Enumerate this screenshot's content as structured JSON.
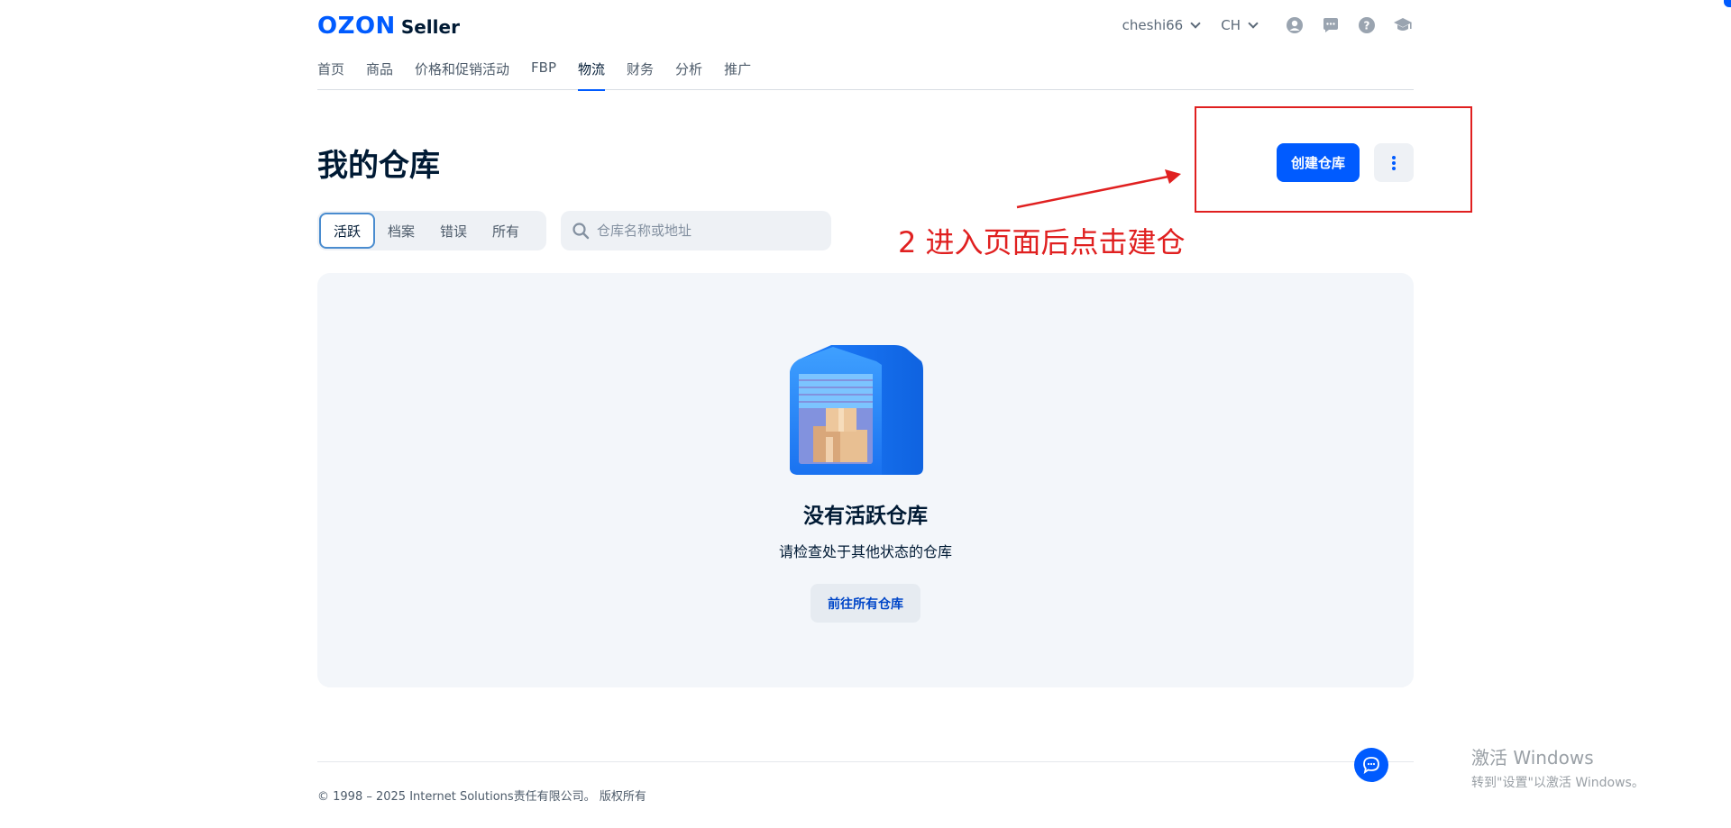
{
  "header": {
    "logo_brand": "OZON",
    "logo_product": "Seller",
    "account": "cheshi66",
    "language": "CH",
    "icons": [
      "profile-icon",
      "chat-icon",
      "help-icon",
      "education-icon"
    ]
  },
  "nav": {
    "items": [
      {
        "label": "首页",
        "active": false
      },
      {
        "label": "商品",
        "active": false
      },
      {
        "label": "价格和促销活动",
        "active": false
      },
      {
        "label": "FBP",
        "active": false
      },
      {
        "label": "物流",
        "active": true
      },
      {
        "label": "财务",
        "active": false
      },
      {
        "label": "分析",
        "active": false
      },
      {
        "label": "推广",
        "active": false
      }
    ]
  },
  "page": {
    "title": "我的仓库",
    "create_button": "创建仓库"
  },
  "filters": {
    "tabs": [
      {
        "label": "活跃",
        "active": true
      },
      {
        "label": "档案",
        "active": false
      },
      {
        "label": "错误",
        "active": false
      },
      {
        "label": "所有",
        "active": false
      }
    ],
    "search_placeholder": "仓库名称或地址"
  },
  "empty_state": {
    "title": "没有活跃仓库",
    "subtitle": "请检查处于其他状态的仓库",
    "button": "前往所有仓库"
  },
  "annotation": {
    "text": "2 进入页面后点击建仓",
    "color": "#e02020"
  },
  "footer": {
    "copyright": "© 1998 – 2025 Internet Solutions责任有限公司。 版权所有"
  },
  "watermark": {
    "line1": "激活 Windows",
    "line2": "转到\"设置\"以激活 Windows。"
  },
  "colors": {
    "accent": "#005bff",
    "text": "#001a34",
    "panel": "#f3f6fa"
  }
}
